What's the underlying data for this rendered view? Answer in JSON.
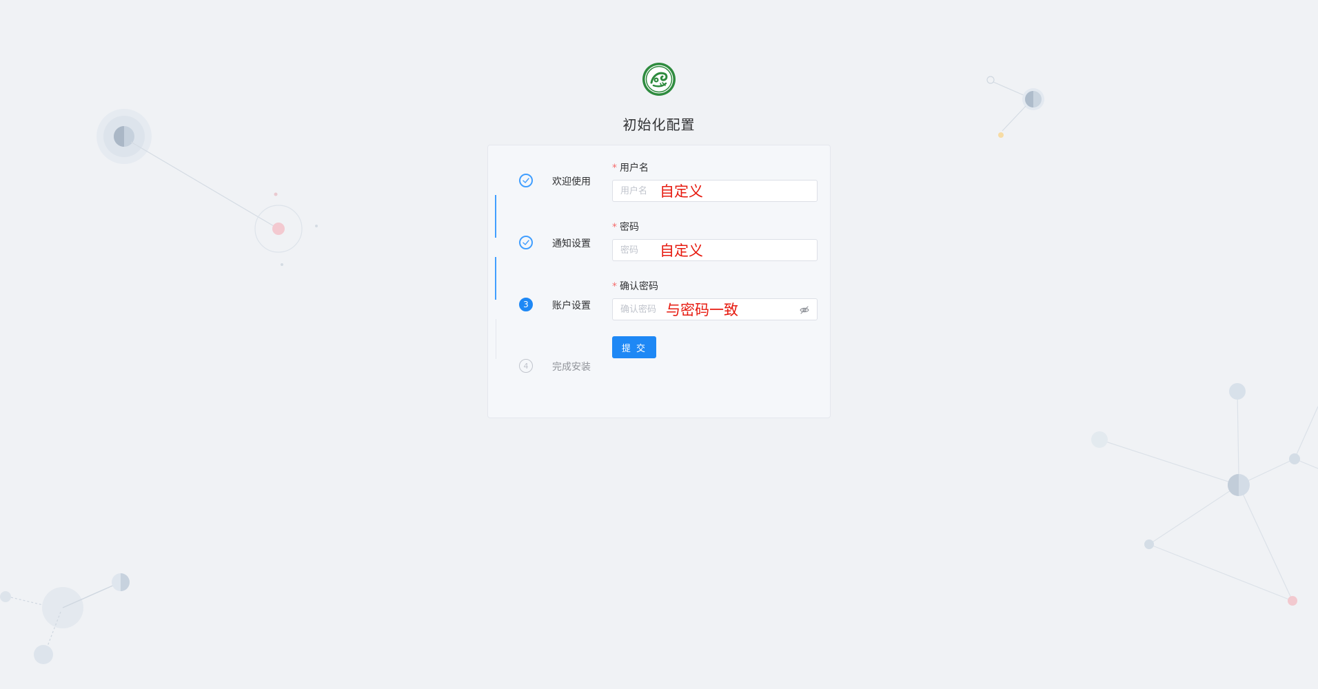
{
  "header": {
    "logo_icon": "dragon-emblem-icon",
    "title": "初始化配置"
  },
  "steps": [
    {
      "label": "欢迎使用",
      "status": "done",
      "icon": "check-icon"
    },
    {
      "label": "通知设置",
      "status": "done",
      "icon": "check-icon"
    },
    {
      "label": "账户设置",
      "status": "active",
      "number": "3"
    },
    {
      "label": "完成安装",
      "status": "pending",
      "number": "4"
    }
  ],
  "form": {
    "username": {
      "label": "用户名",
      "required_mark": "*",
      "placeholder": "用户名",
      "annotation": "自定义"
    },
    "password": {
      "label": "密码",
      "required_mark": "*",
      "placeholder": "密码",
      "annotation": "自定义"
    },
    "confirm": {
      "label": "确认密码",
      "required_mark": "*",
      "placeholder": "确认密码",
      "annotation": "与密码一致",
      "toggle_icon": "eye-off-icon"
    },
    "submit_label": "提 交"
  },
  "colors": {
    "primary": "#1e88f5",
    "step_done": "#409eff",
    "required": "#f56c6c",
    "annotation": "#e6180d",
    "background": "#f0f2f5"
  }
}
